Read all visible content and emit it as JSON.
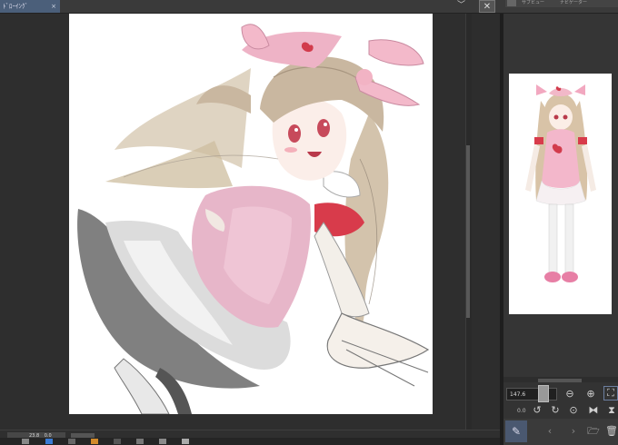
{
  "header": {
    "tab_title": "ﾄﾞﾛｰｲﾝｸﾞ",
    "tab_close": "×",
    "menu_chevron": "﹀",
    "window_close": "✕",
    "right_tabs": [
      "サブビュー",
      "ナビゲーター"
    ]
  },
  "navigator": {
    "zoom_value": "147.6",
    "angle_value": "0.0"
  },
  "status": {
    "zoom_value": "23.8",
    "angle_value": "0.0"
  },
  "icons": {
    "zoom_out": "zoom-out-icon",
    "zoom_in": "zoom-in-icon",
    "fit": "fit-screen-icon",
    "rotate_left": "rotate-left-icon",
    "rotate_right": "rotate-right-icon",
    "reset": "reset-rotation-icon",
    "flip": "flip-horizontal-icon",
    "flip_v": "flip-vertical-icon",
    "eyedropper": "eyedropper-icon",
    "prev": "chevron-left-icon",
    "next": "chevron-right-icon",
    "folder": "folder-icon",
    "trash": "trash-icon"
  },
  "colors": {
    "accent": "#4b5f7a",
    "canvas": "#ffffff",
    "panel": "#353535",
    "hair": "#c9b7a0",
    "pink": "#e8a6c0",
    "apron_pink": "#e7b6c9",
    "red": "#d83b4b"
  }
}
